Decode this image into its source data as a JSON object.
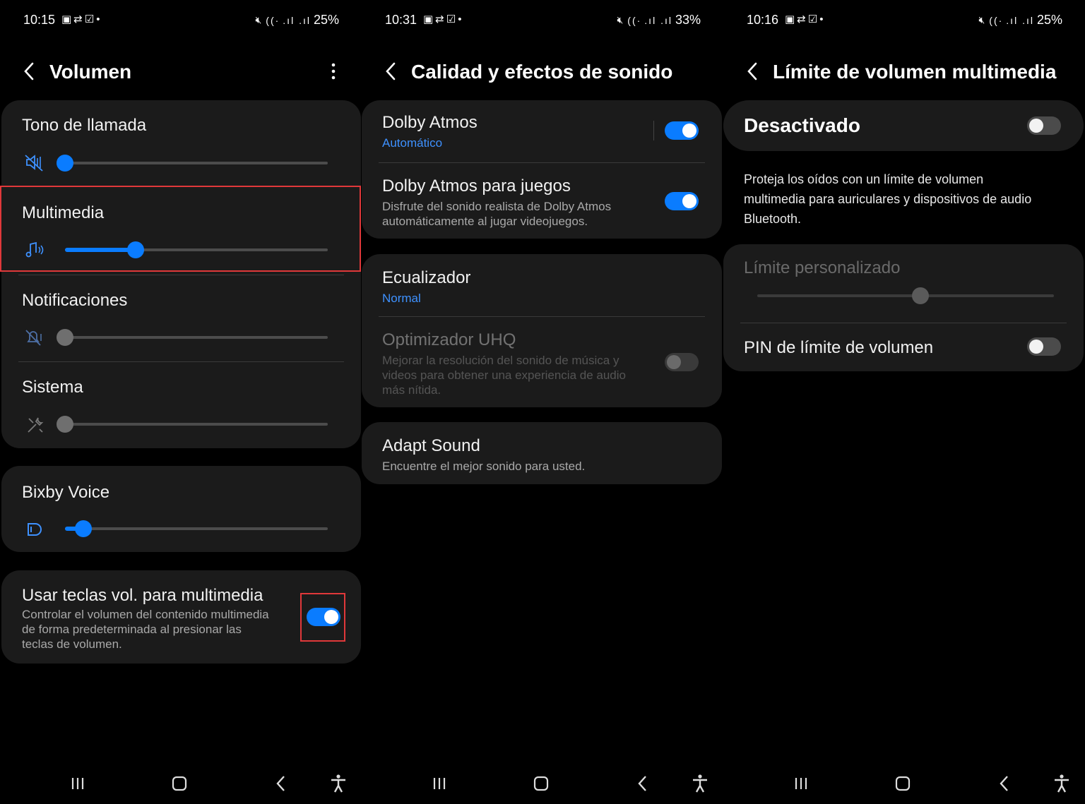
{
  "colors": {
    "accent": "#0a7cff",
    "link": "#3e91ff",
    "card": "#1b1b1b",
    "highlight": "#e0383a"
  },
  "panel1": {
    "status": {
      "time": "10:15",
      "battery": "25%"
    },
    "title": "Volumen",
    "ringtone": {
      "label": "Tono de llamada",
      "level": 0.0,
      "icon": "mute-vibrate-icon"
    },
    "media": {
      "label": "Multimedia",
      "level": 0.27,
      "icon": "music-note-icon"
    },
    "notifications": {
      "label": "Notificaciones",
      "level": 0.0,
      "icon": "bell-off-icon"
    },
    "system": {
      "label": "Sistema",
      "level": 0.0,
      "icon": "wrench-icon"
    },
    "bixby": {
      "label": "Bixby Voice",
      "level": 0.07,
      "icon": "bixby-icon"
    },
    "vol_keys": {
      "label": "Usar teclas vol. para multimedia",
      "desc1": "Controlar el volumen del contenido multimedia",
      "desc2": "de forma predeterminada al presionar las",
      "desc3": "teclas de volumen.",
      "on": true
    }
  },
  "panel2": {
    "status": {
      "time": "10:31",
      "battery": "33%"
    },
    "title": "Calidad y efectos de sonido",
    "dolby": {
      "label": "Dolby Atmos",
      "value": "Automático",
      "on": true
    },
    "dolby_games": {
      "label": "Dolby Atmos para juegos",
      "desc1": "Disfrute del sonido realista de Dolby Atmos",
      "desc2": "automáticamente al jugar videojuegos.",
      "on": true
    },
    "equalizer": {
      "label": "Ecualizador",
      "value": "Normal"
    },
    "uhq": {
      "label": "Optimizador UHQ",
      "desc1": "Mejorar la resolución del sonido de música y",
      "desc2": "videos para obtener una experiencia de audio",
      "desc3": "más nítida.",
      "on": false,
      "enabled": false
    },
    "adapt": {
      "label": "Adapt Sound",
      "desc": "Encuentre el mejor sonido para usted."
    }
  },
  "panel3": {
    "status": {
      "time": "10:16",
      "battery": "25%"
    },
    "title": "Límite de volumen multimedia",
    "master": {
      "label": "Desactivado",
      "on": false
    },
    "description": {
      "line1": "Proteja los oídos con un límite de volumen",
      "line2": "multimedia para auriculares y dispositivos de audio",
      "line3": "Bluetooth."
    },
    "custom_limit": {
      "label": "Límite personalizado",
      "level": 0.55,
      "enabled": false
    },
    "pin": {
      "label": "PIN de límite de volumen",
      "on": false
    }
  }
}
